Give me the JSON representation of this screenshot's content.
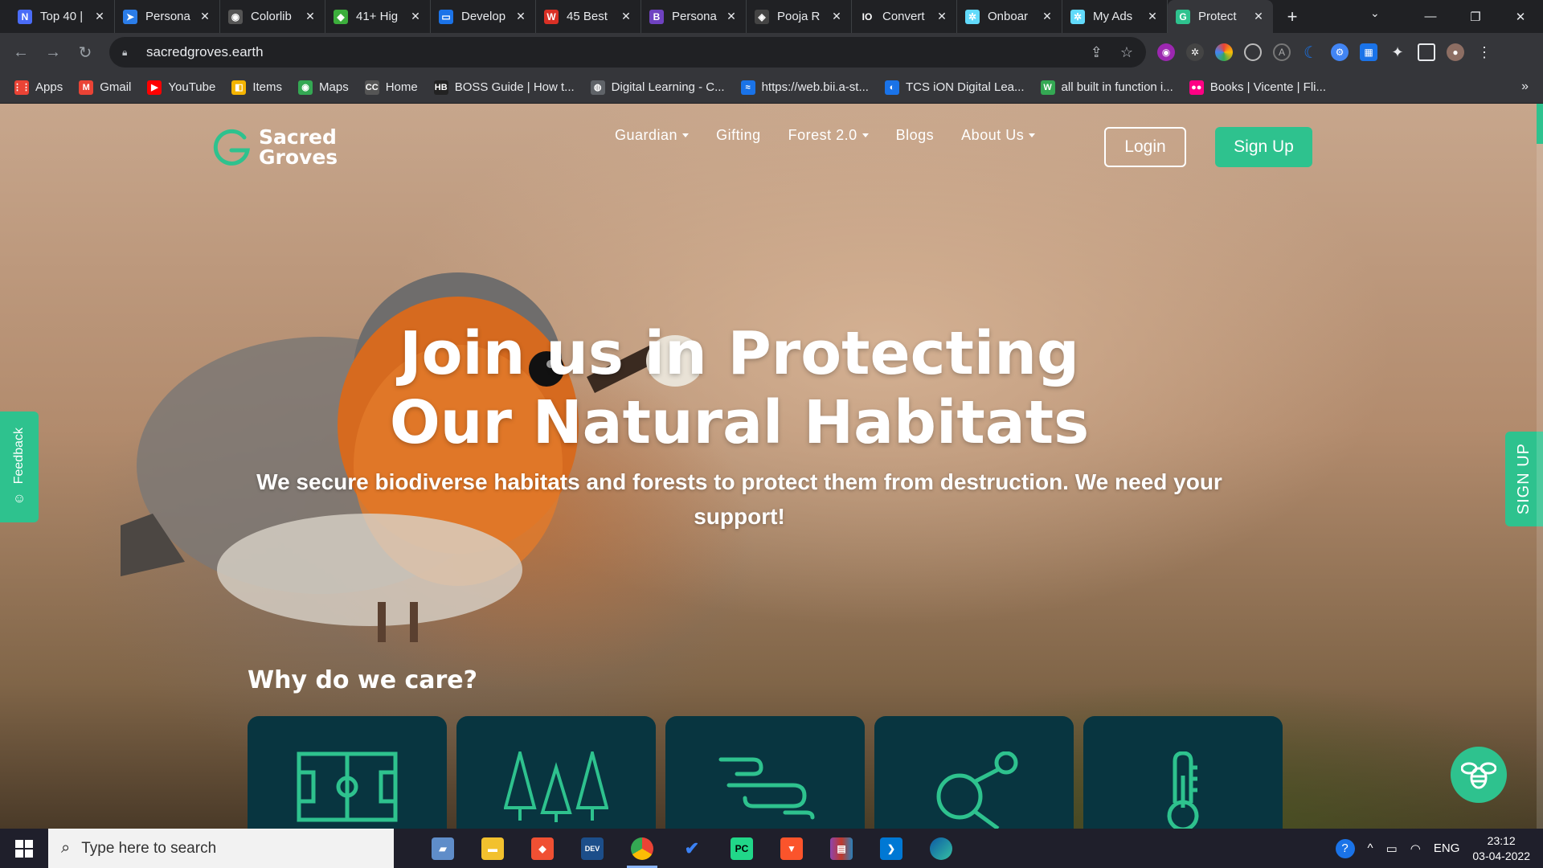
{
  "browser": {
    "tabs": [
      {
        "title": "Top 40 |",
        "icon": "N",
        "color": "#4a6cf7"
      },
      {
        "title": "Persona",
        "icon": "➤",
        "color": "#2b7de9"
      },
      {
        "title": "Colorlib",
        "icon": "◉",
        "color": "#555555"
      },
      {
        "title": "41+ Hig",
        "icon": "◆",
        "color": "#3cae3c"
      },
      {
        "title": "Develop",
        "icon": "▭",
        "color": "#1b73e8"
      },
      {
        "title": "45 Best",
        "icon": "W",
        "color": "#d93025"
      },
      {
        "title": "Persona",
        "icon": "B",
        "color": "#6f42c1"
      },
      {
        "title": "Pooja R",
        "icon": "◈",
        "color": "#444444"
      },
      {
        "title": "Convert",
        "icon": "IO",
        "color": "#202124"
      },
      {
        "title": "Onboar",
        "icon": "✲",
        "color": "#61dafb"
      },
      {
        "title": "My Ads",
        "icon": "✲",
        "color": "#61dafb"
      },
      {
        "title": "Protect",
        "icon": "G",
        "color": "#2ec28e",
        "active": true
      }
    ],
    "url": "sacredgroves.earth",
    "bookmarks": [
      {
        "label": "Apps",
        "icon": "⋮⋮",
        "color": "#ea4335"
      },
      {
        "label": "Gmail",
        "icon": "M",
        "color": "#ea4335"
      },
      {
        "label": "YouTube",
        "icon": "▶",
        "color": "#ff0000"
      },
      {
        "label": "Items",
        "icon": "◧",
        "color": "#f4b400"
      },
      {
        "label": "Maps",
        "icon": "◉",
        "color": "#34a853"
      },
      {
        "label": "Home",
        "icon": "CC",
        "color": "#555555"
      },
      {
        "label": "BOSS Guide | How t...",
        "icon": "HB",
        "color": "#222222"
      },
      {
        "label": "Digital Learning - C...",
        "icon": "◍",
        "color": "#5f6368"
      },
      {
        "label": "https://web.bii.a-st...",
        "icon": "≈",
        "color": "#1a73e8"
      },
      {
        "label": "TCS iON Digital Lea...",
        "icon": "◐",
        "color": "#1a73e8"
      },
      {
        "label": "all built in function i...",
        "icon": "W",
        "color": "#34a853"
      },
      {
        "label": "Books | Vicente | Fli...",
        "icon": "●●",
        "color": "#ff0084"
      }
    ],
    "bookmarks_more": "»"
  },
  "site": {
    "logo_line1": "Sacred",
    "logo_line2": "Groves",
    "nav": {
      "guardian": "Guardian",
      "gifting": "Gifting",
      "forest": "Forest 2.0",
      "blogs": "Blogs",
      "about": "About Us"
    },
    "login": "Login",
    "signup": "Sign Up",
    "hero_title_line1": "Join us in Protecting",
    "hero_title_line2": "Our Natural Habitats",
    "hero_subtitle": "We secure biodiverse habitats and forests to protect them from destruction. We need your support!",
    "why_title": "Why do we care?",
    "cards": [
      "field-icon",
      "trees-icon",
      "wind-icon",
      "molecule-icon",
      "thermometer-icon"
    ],
    "feedback": "Feedback",
    "side_signup": "SIGN UP",
    "accent": "#2ec28e",
    "card_bg": "#083540"
  },
  "taskbar": {
    "search_placeholder": "Type here to search",
    "lang": "ENG",
    "time": "23:12",
    "date": "03-04-2022"
  }
}
